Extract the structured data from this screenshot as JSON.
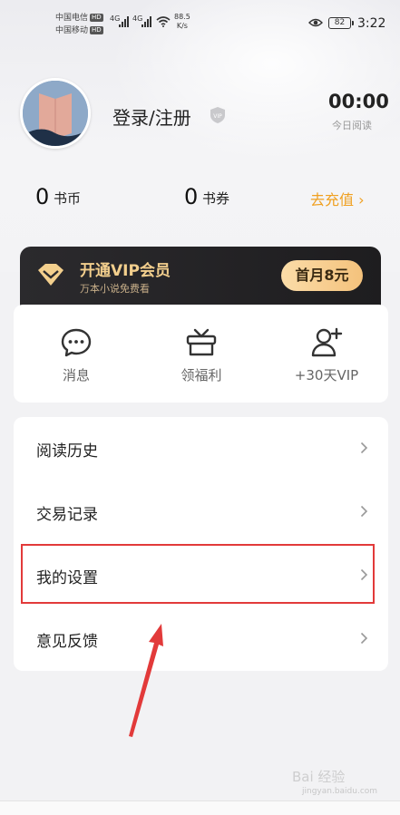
{
  "status_bar": {
    "carrier1": "中国电信",
    "carrier2": "中国移动",
    "hd": "HD",
    "net1": "4G",
    "net2": "4G",
    "speed_value": "88.5",
    "speed_unit": "K/s",
    "battery": "82",
    "time": "3:22"
  },
  "profile": {
    "login_label": "登录/注册",
    "read_time": "00:00",
    "read_time_label": "今日阅读"
  },
  "wallet": {
    "coins_value": "0",
    "coins_label": "书币",
    "vouchers_value": "0",
    "vouchers_label": "书券",
    "recharge_label": "去充值 ›"
  },
  "vip": {
    "title": "开通VIP会员",
    "subtitle": "万本小说免费看",
    "button": "首月8元"
  },
  "quick_actions": [
    {
      "label": "消息",
      "icon": "message-icon"
    },
    {
      "label": "领福利",
      "icon": "gift-tv-icon"
    },
    {
      "label": "+30天VIP",
      "icon": "add-user-icon"
    }
  ],
  "menu": [
    {
      "label": "阅读历史"
    },
    {
      "label": "交易记录"
    },
    {
      "label": "我的设置"
    },
    {
      "label": "意见反馈"
    }
  ],
  "watermark": {
    "text": "Bai 经验",
    "sub": "jingyan.baidu.com"
  },
  "colors": {
    "accent_orange": "#f0a020",
    "vip_gold": "#f3cf8d",
    "highlight_red": "#e23a3a"
  }
}
